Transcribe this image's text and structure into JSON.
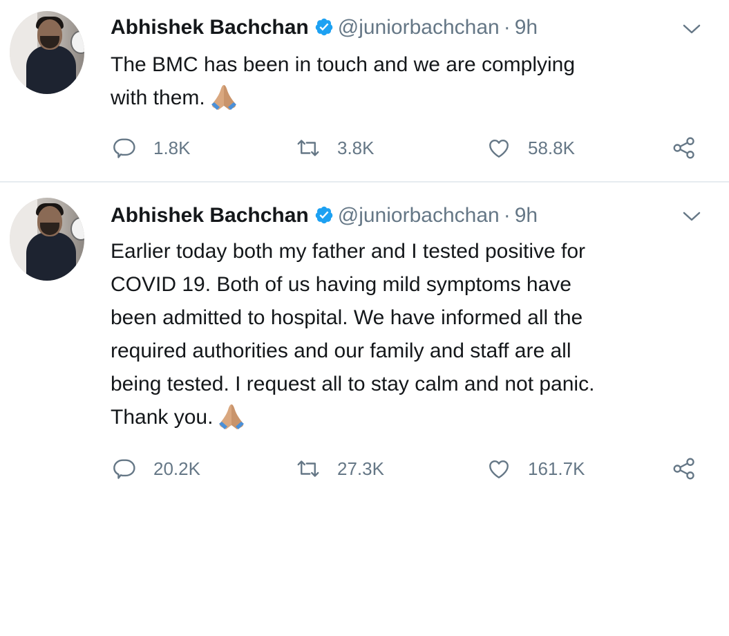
{
  "colors": {
    "text": "#14171a",
    "secondary": "#657786",
    "verified": "#1da1f2",
    "divider": "#e6ecf0",
    "icon": "#657786"
  },
  "tweets": [
    {
      "author": {
        "name": "Abhishek Bachchan",
        "handle": "@juniorbachchan",
        "verified": true
      },
      "time": "9h",
      "text_lines": [
        "The BMC has been in touch and we are complying",
        "with them."
      ],
      "emoji": "folded-hands-emoji",
      "stats": {
        "replies": "1.8K",
        "retweets": "3.8K",
        "likes": "58.8K"
      }
    },
    {
      "author": {
        "name": "Abhishek Bachchan",
        "handle": "@juniorbachchan",
        "verified": true
      },
      "time": "9h",
      "text_lines": [
        "Earlier today both my father and I tested positive for",
        "COVID 19. Both of us having mild symptoms have",
        "been admitted to hospital. We have informed all the",
        "required authorities and our family and staff are all",
        "being tested. I request all to stay calm and not panic.",
        "Thank you."
      ],
      "emoji": "folded-hands-emoji",
      "stats": {
        "replies": "20.2K",
        "retweets": "27.3K",
        "likes": "161.7K"
      }
    }
  ],
  "separator": "·"
}
